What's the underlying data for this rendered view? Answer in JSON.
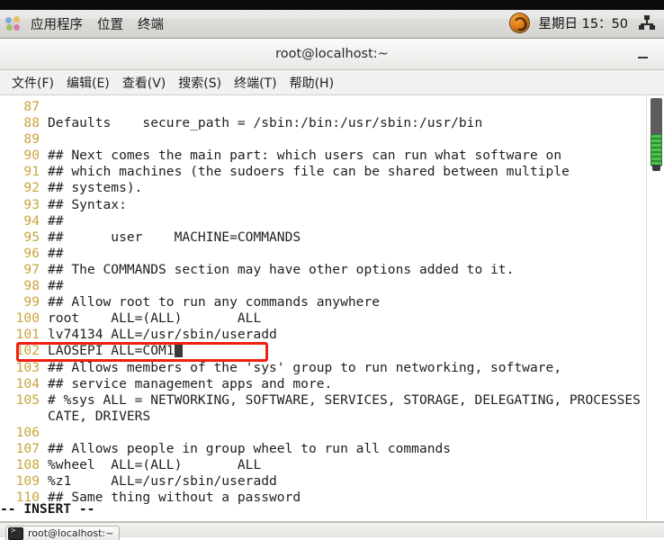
{
  "top_panel": {
    "applications_icon": "applications-flower-icon",
    "menus": [
      {
        "label": "应用程序",
        "name": "panel-menu-applications"
      },
      {
        "label": "位置",
        "name": "panel-menu-places"
      },
      {
        "label": "终端",
        "name": "panel-menu-terminal"
      }
    ],
    "indicator_icon": "firefox-circle-icon",
    "clock": "星期日 15：50",
    "network_icon": "network-workspace-icon"
  },
  "window": {
    "title": "root@localhost:~",
    "minimize_label": "—",
    "menubar": [
      {
        "label": "文件(F)",
        "name": "menu-file"
      },
      {
        "label": "编辑(E)",
        "name": "menu-edit"
      },
      {
        "label": "查看(V)",
        "name": "menu-view"
      },
      {
        "label": "搜索(S)",
        "name": "menu-search"
      },
      {
        "label": "终端(T)",
        "name": "menu-terminal"
      },
      {
        "label": "帮助(H)",
        "name": "menu-help"
      }
    ]
  },
  "editor": {
    "line_number_color": "#c8a53c",
    "annotation_color": "#f01f10",
    "status_line": "-- INSERT --",
    "cursor_after_line": "102",
    "lines": [
      {
        "no": "87",
        "text": ""
      },
      {
        "no": "88",
        "text": "Defaults    secure_path = /sbin:/bin:/usr/sbin:/usr/bin"
      },
      {
        "no": "89",
        "text": ""
      },
      {
        "no": "90",
        "text": "## Next comes the main part: which users can run what software on"
      },
      {
        "no": "91",
        "text": "## which machines (the sudoers file can be shared between multiple"
      },
      {
        "no": "92",
        "text": "## systems)."
      },
      {
        "no": "93",
        "text": "## Syntax:"
      },
      {
        "no": "94",
        "text": "##"
      },
      {
        "no": "95",
        "text": "##      user    MACHINE=COMMANDS"
      },
      {
        "no": "96",
        "text": "##"
      },
      {
        "no": "97",
        "text": "## The COMMANDS section may have other options added to it."
      },
      {
        "no": "98",
        "text": "##"
      },
      {
        "no": "99",
        "text": "## Allow root to run any commands anywhere"
      },
      {
        "no": "100",
        "text": "root    ALL=(ALL)       ALL"
      },
      {
        "no": "101",
        "text": "lv74134 ALL=/usr/sbin/useradd"
      },
      {
        "no": "102",
        "text": "LAOSEPI ALL=COM1",
        "highlighted": true
      },
      {
        "no": "103",
        "text": "## Allows members of the 'sys' group to run networking, software,"
      },
      {
        "no": "104",
        "text": "## service management apps and more."
      },
      {
        "no": "105",
        "text": "# %sys ALL = NETWORKING, SOFTWARE, SERVICES, STORAGE, DELEGATING, PROCESSES"
      },
      {
        "no": "",
        "text": "CATE, DRIVERS",
        "wrapped": true
      },
      {
        "no": "106",
        "text": ""
      },
      {
        "no": "107",
        "text": "## Allows people in group wheel to run all commands"
      },
      {
        "no": "108",
        "text": "%wheel  ALL=(ALL)       ALL"
      },
      {
        "no": "109",
        "text": "%z1     ALL=/usr/sbin/useradd"
      },
      {
        "no": "110",
        "text": "## Same thing without a password"
      }
    ]
  },
  "scrollbar": {
    "name": "vertical-scrollbar",
    "thumb_color": "#4fc24f"
  },
  "taskbar": {
    "items": [
      {
        "label": "root@localhost:~",
        "icon": "terminal-icon",
        "name": "taskbar-item-terminal"
      }
    ]
  }
}
